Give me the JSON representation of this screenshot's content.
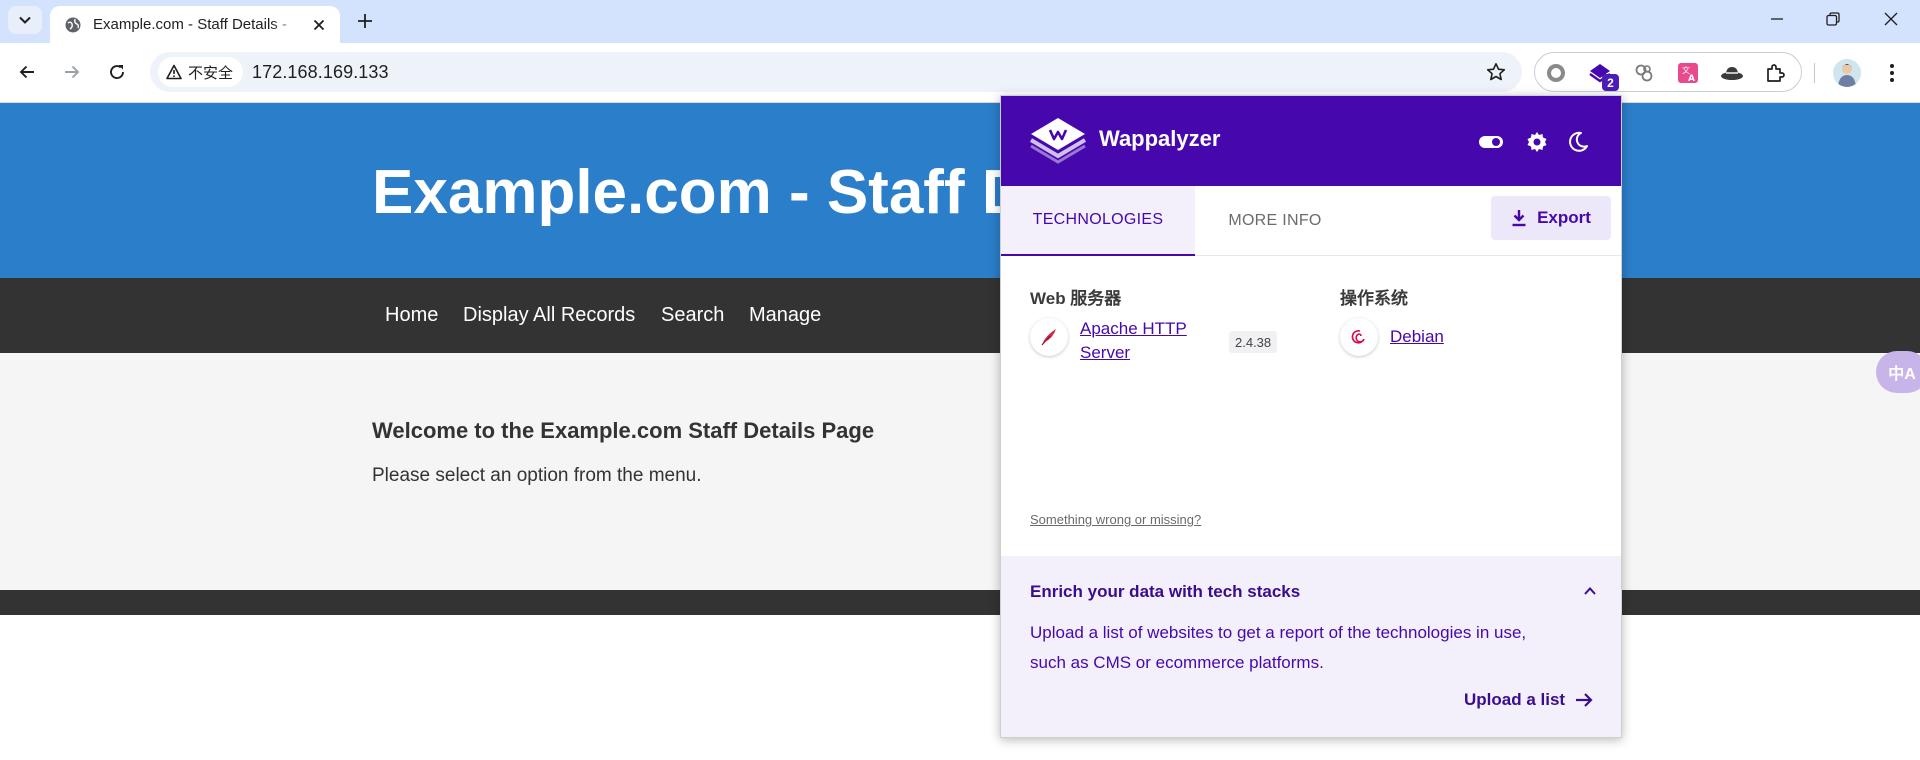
{
  "browser": {
    "tab_title": "Example.com - Staff Details - ",
    "url": "172.168.169.133",
    "security_label": "不安全",
    "extension_badge": "2"
  },
  "site": {
    "title": "Example.com - Staff Details",
    "nav": [
      "Home",
      "Display All Records",
      "Search",
      "Manage"
    ],
    "welcome_heading": "Welcome to the Example.com Staff Details Page",
    "welcome_text": "Please select an option from the menu.",
    "translate_fab": "中A"
  },
  "wappalyzer": {
    "brand": "Wappalyzer",
    "tabs": [
      "TECHNOLOGIES",
      "MORE INFO"
    ],
    "export_label": "Export",
    "categories": [
      {
        "name": "Web 服务器",
        "technologies": [
          {
            "name": "Apache HTTP Server",
            "version": "2.4.38",
            "icon": "apache-feather-icon"
          }
        ]
      },
      {
        "name": "操作系统",
        "technologies": [
          {
            "name": "Debian",
            "version": "",
            "icon": "debian-swirl-icon"
          }
        ]
      }
    ],
    "wrong_link": "Something wrong or missing?",
    "enrich": {
      "title": "Enrich your data with tech stacks",
      "text": "Upload a list of websites to get a report of the technologies in use, such as CMS or ecommerce platforms.",
      "upload_label": "Upload a list"
    },
    "accent_color": "#4608ad"
  },
  "colors": {
    "site_header": "#2b7ec9",
    "site_nav": "#333333",
    "tabbar": "#d3e3fd"
  }
}
